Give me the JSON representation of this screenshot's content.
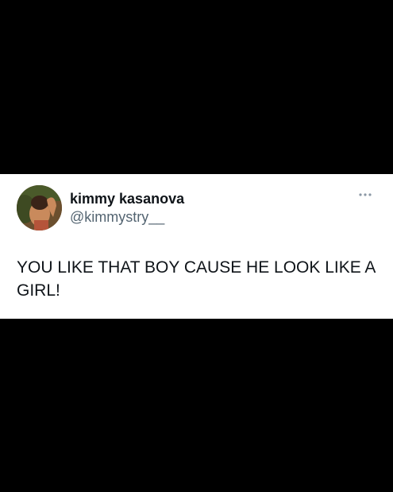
{
  "tweet": {
    "display_name": "kimmy kasanova",
    "handle": "@kimmystry__",
    "text": "YOU LIKE THAT BOY CAUSE HE LOOK LIKE A GIRL!",
    "avatar_icon": "profile-photo",
    "menu_icon": "more-options-icon"
  },
  "colors": {
    "background": "#000000",
    "card": "#ffffff",
    "name": "#0f1419",
    "handle": "#536471"
  }
}
